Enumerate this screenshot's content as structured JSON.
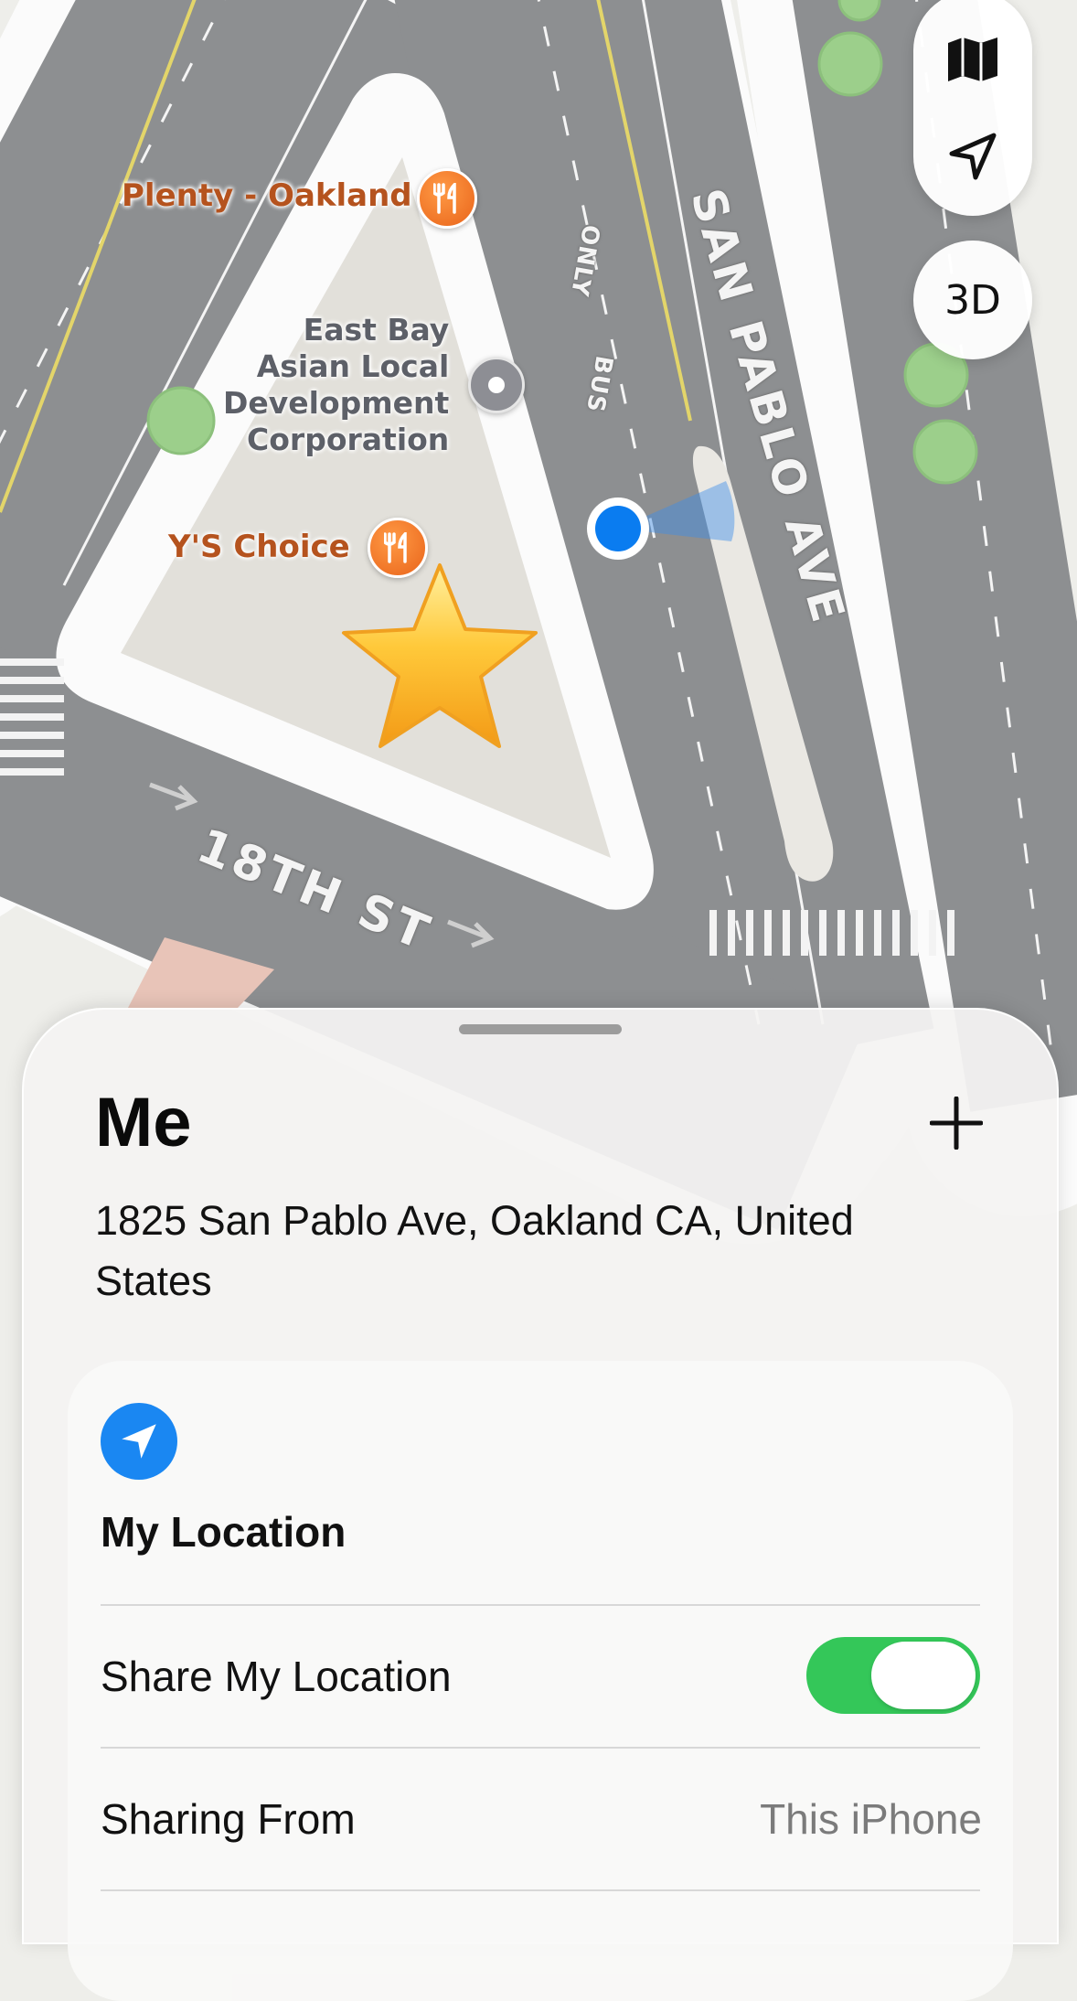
{
  "map": {
    "pois": {
      "plenty": "Plenty - Oakland",
      "east_bay": [
        "East Bay",
        "Asian Local",
        "Development",
        "Corporation"
      ],
      "ys_choice": "Y'S Choice"
    },
    "streets": {
      "san_pablo": "SAN PABLO AVE",
      "eighteenth": "18TH ST"
    },
    "road_markings": [
      "ONLY",
      "BUS"
    ],
    "favorite_marker": "⭐"
  },
  "controls": {
    "map_mode_icon": "map-icon",
    "location_icon": "location-arrow-icon",
    "three_d_label": "3D"
  },
  "sheet": {
    "title": "Me",
    "add_icon": "plus-icon",
    "address": "1825 San Pablo Ave, Oakland CA, United States",
    "card": {
      "heading": "My Location",
      "share_label": "Share My Location",
      "share_enabled": true,
      "sharing_from_label": "Sharing From",
      "sharing_from_value": "This iPhone"
    }
  },
  "colors": {
    "accent_blue": "#1a87f2",
    "toggle_green": "#34c759",
    "poi_food": "#e9641a"
  }
}
